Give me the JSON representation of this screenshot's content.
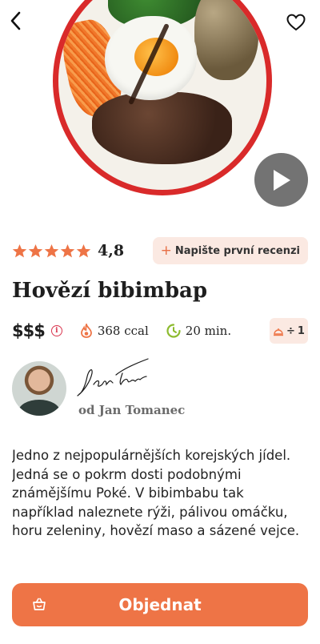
{
  "colors": {
    "accent": "#ee7446",
    "accent_soft": "#fbe9e2",
    "star": "#ee7446",
    "info_red": "#d9364f",
    "time_green": "#8dbb2f",
    "plate_red": "#d92a2a"
  },
  "icons": {
    "back": "chevron-left-icon",
    "favorite": "heart-outline-icon",
    "play": "play-icon",
    "star": "star-icon",
    "info": "info-icon",
    "calories": "flame-icon",
    "time": "clock-icon",
    "servings": "dish-cover-icon",
    "order": "basket-icon"
  },
  "rating": {
    "stars": 5,
    "value": "4,8"
  },
  "review_button": {
    "plus": "+",
    "label": "Napište první recenzi"
  },
  "recipe": {
    "title": "Hovězí bibimbap",
    "price": "$$$",
    "info_mark": "i",
    "calories": "368 ccal",
    "time": "20 min.",
    "servings_prefix": "÷",
    "servings": "1"
  },
  "author": {
    "name": "od Jan Tomanec"
  },
  "description": "Jedno z nejpopulárnějších korejských jídel. Jedná se o pokrm dosti podobnými známějšímu Poké. V bibimbabu tak například naleznete rýži, pálivou omáčku, horu zeleniny, hovězí maso a sázené vejce.",
  "order_button": {
    "label": "Objednat"
  }
}
